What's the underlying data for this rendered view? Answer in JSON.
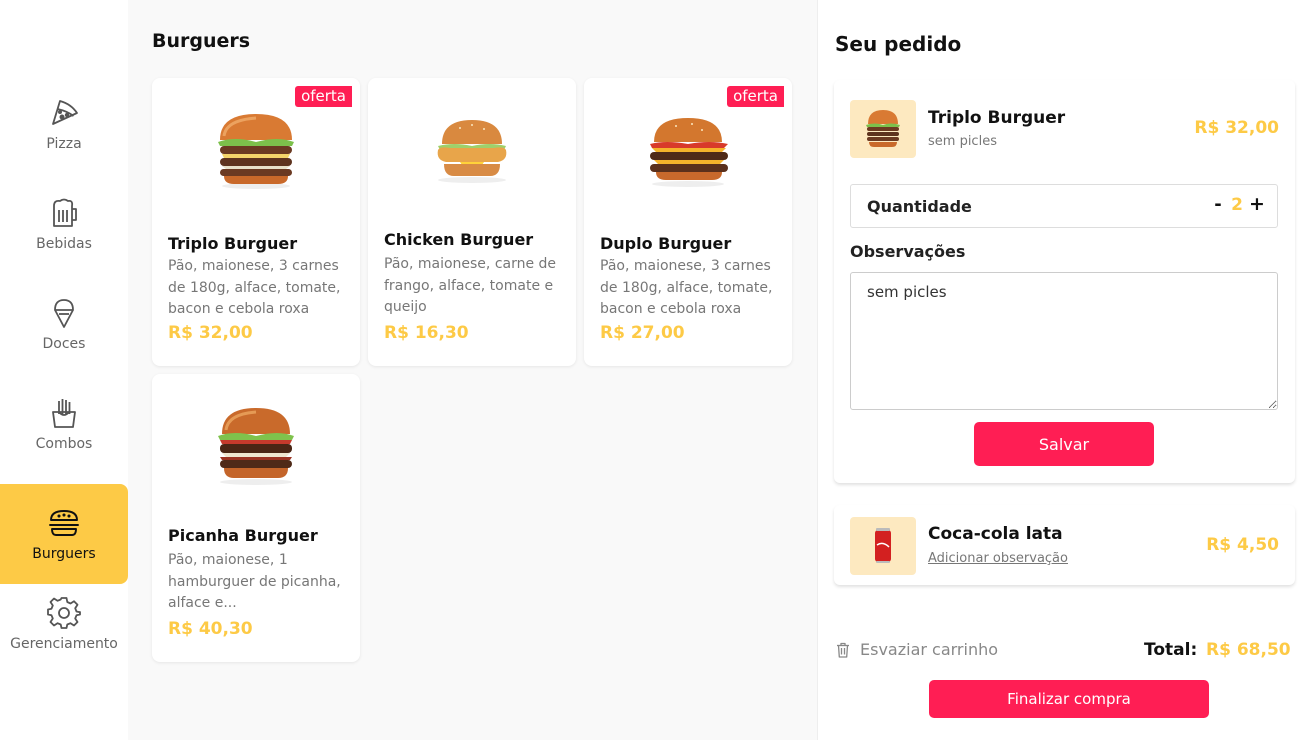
{
  "sidebar": {
    "items": [
      {
        "label": "Pizza",
        "icon": "pizza-icon"
      },
      {
        "label": "Bebidas",
        "icon": "beer-mug-icon"
      },
      {
        "label": "Doces",
        "icon": "ice-cream-icon"
      },
      {
        "label": "Combos",
        "icon": "fries-icon"
      },
      {
        "label": "Burguers",
        "icon": "burger-icon",
        "active": true
      },
      {
        "label": "Gerenciamento",
        "icon": "gear-icon"
      }
    ]
  },
  "main": {
    "title": "Burguers",
    "products": [
      {
        "name": "Triplo Burguer",
        "description": "Pão, maionese, 3 carnes de 180g, alface, tomate, bacon e cebola roxa",
        "price": "R$ 32,00",
        "badge": "oferta"
      },
      {
        "name": "Chicken Burguer",
        "description": "Pão, maionese, carne de frango, alface, tomate e queijo",
        "price": "R$ 16,30",
        "badge": ""
      },
      {
        "name": "Duplo Burguer",
        "description": "Pão, maionese, 3 carnes de 180g, alface, tomate, bacon e cebola roxa",
        "price": "R$ 27,00",
        "badge": "oferta"
      },
      {
        "name": "Picanha Burguer",
        "description": "Pão, maionese, 1 hamburguer de picanha, alface e...",
        "price": "R$ 40,30",
        "badge": ""
      }
    ]
  },
  "order": {
    "title": "Seu pedido",
    "items": [
      {
        "name": "Triplo Burguer",
        "note": "sem picles",
        "price": "R$ 32,00"
      },
      {
        "name": "Coca-cola lata",
        "link": "Adicionar observação",
        "price": "R$ 4,50"
      }
    ],
    "quantity_label": "Quantidade",
    "quantity_minus": "-",
    "quantity_value": "2",
    "quantity_plus": "+",
    "observations_label": "Observações",
    "observations_value": "sem picles",
    "save_label": "Salvar",
    "empty_cart_label": "Esvaziar carrinho",
    "total_label": "Total:",
    "total_value": "R$ 68,50",
    "finish_label": "Finalizar compra"
  },
  "colors": {
    "accent_yellow": "#fdca46",
    "accent_red": "#ff1e54",
    "thumb_bg": "#fde9c0"
  }
}
